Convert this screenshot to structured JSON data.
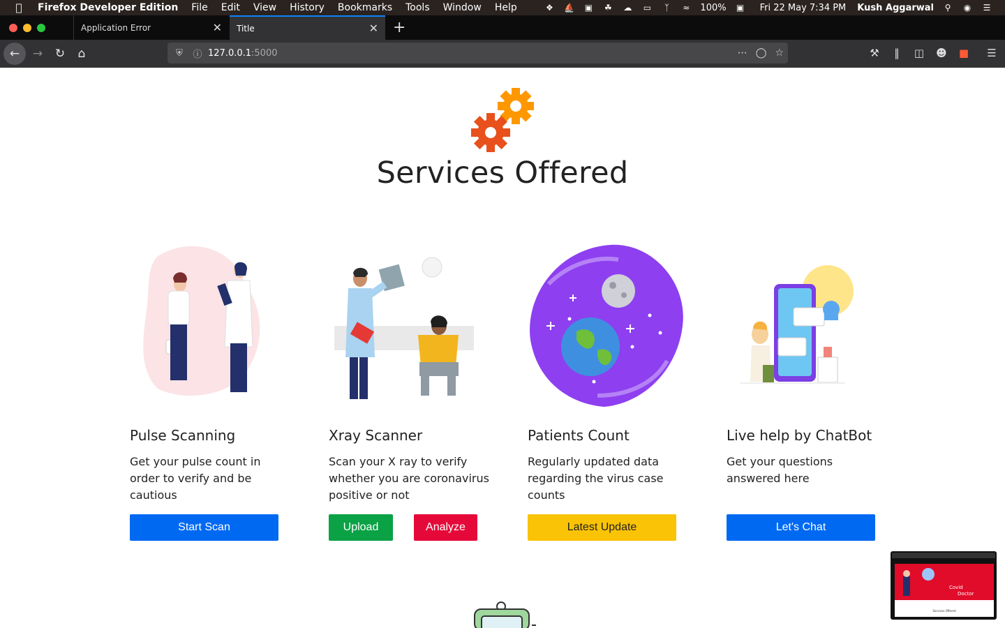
{
  "menubar": {
    "app_name": "Firefox Developer Edition",
    "items": [
      "File",
      "Edit",
      "View",
      "History",
      "Bookmarks",
      "Tools",
      "Window",
      "Help"
    ],
    "battery": "100%",
    "datetime": "Fri 22 May  7:34 PM",
    "user": "Kush Aggarwal"
  },
  "tabs": [
    {
      "label": "Application Error",
      "active": false
    },
    {
      "label": "Title",
      "active": true
    }
  ],
  "urlbar": {
    "host": "127.0.0.1",
    "port": ":5000"
  },
  "page": {
    "title": "Services Offered"
  },
  "cards": [
    {
      "title": "Pulse Scanning",
      "text": "Get your pulse count in order to verify and be cautious",
      "buttons": [
        {
          "label": "Start Scan",
          "color": "#0069f2"
        }
      ]
    },
    {
      "title": "Xray Scanner",
      "text": "Scan your X ray to verify whether you are coronavirus positive or not",
      "buttons": [
        {
          "label": "Upload",
          "color": "#0aa245"
        },
        {
          "label": "Analyze",
          "color": "#e5093a"
        }
      ]
    },
    {
      "title": "Patients Count",
      "text": "Regularly updated data regarding the virus case counts",
      "buttons": [
        {
          "label": "Latest Update",
          "color": "#fac305"
        }
      ]
    },
    {
      "title": "Live help by ChatBot",
      "text": "Get your questions answered here",
      "buttons": [
        {
          "label": "Let's Chat",
          "color": "#0069f2"
        }
      ]
    }
  ],
  "thumbnail": {
    "hero_text_1": "Covid",
    "hero_text_2": "Doctor",
    "sub_text": "Services Offered"
  }
}
